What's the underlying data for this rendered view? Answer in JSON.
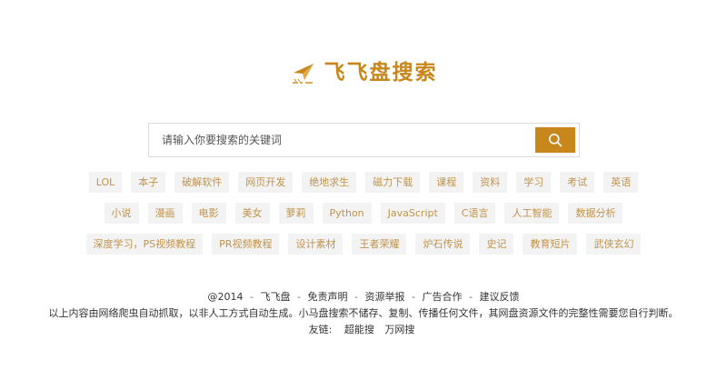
{
  "brand": {
    "name": "飞飞盘搜索",
    "accent": "#c8871a"
  },
  "search": {
    "placeholder": "请输入你要搜索的关键词",
    "button_icon": "search-icon"
  },
  "tag_rows": [
    [
      "LOL",
      "本子",
      "破解软件",
      "网页开发",
      "绝地求生",
      "磁力下载",
      "课程",
      "资料",
      "学习",
      "考试",
      "英语"
    ],
    [
      "小说",
      "漫画",
      "电影",
      "美女",
      "萝莉",
      "Python",
      "JavaScript",
      "C语言",
      "人工智能",
      "数据分析"
    ],
    [
      "深度学习，PS视频教程",
      "PR视频教程",
      "设计素材",
      "王者荣耀",
      "炉石传说",
      "史记",
      "教育短片",
      "武侠玄幻"
    ]
  ],
  "footer": {
    "copyright": "@2014",
    "links": [
      "飞飞盘",
      "免责声明",
      "资源举报",
      "广告合作",
      "建议反馈"
    ],
    "separator": "-",
    "disclaimer": "以上内容由网络爬虫自动抓取，以非人工方式自动生成。小马盘搜索不储存、复制、传播任何文件，其网盘资源文件的完整性需要您自行判断。",
    "friends_label": "友链:",
    "friends": [
      "超能搜",
      "万网搜"
    ]
  }
}
